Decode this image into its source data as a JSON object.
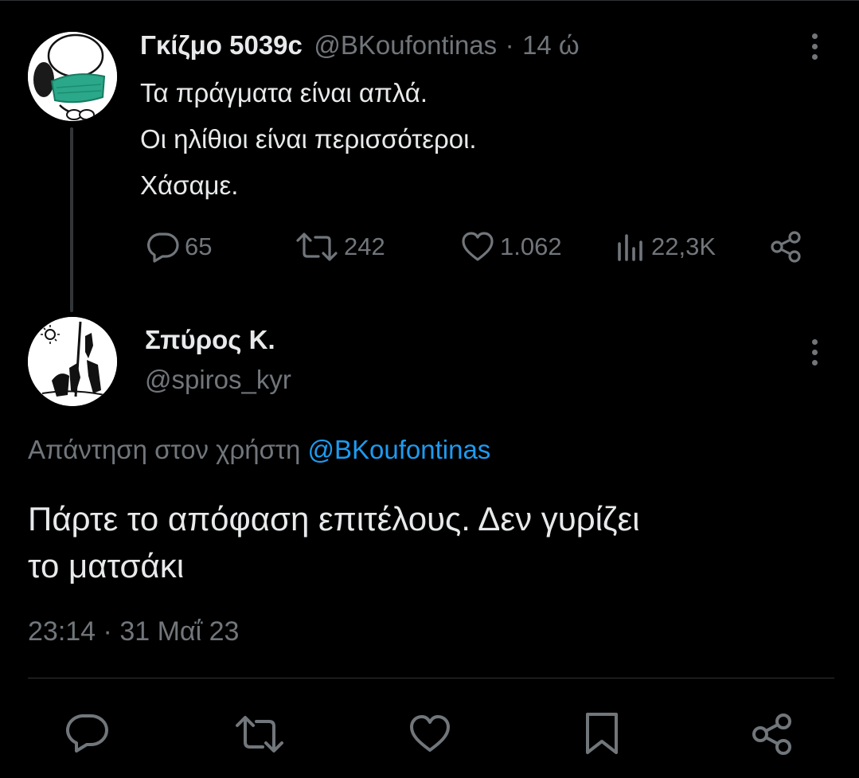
{
  "original_tweet": {
    "author_name": "Γκίζμο 5039c",
    "handle": "@BKoufontinas",
    "separator": "·",
    "time_ago": "14 ώ",
    "lines": [
      "Τα πράγματα είναι απλά.",
      "Οι ηλίθιοι είναι περισσότεροι.",
      "Χάσαμε."
    ],
    "stats": {
      "replies": "65",
      "retweets": "242",
      "likes": "1.062",
      "views": "22,3K"
    },
    "icons": [
      "reply-icon",
      "retweet-icon",
      "like-icon",
      "views-icon",
      "share-icon",
      "more-icon"
    ]
  },
  "reply_tweet": {
    "author_name": "Σπύρος Κ.",
    "handle": "@spiros_kyr",
    "reply_prefix": "Απάντηση στον χρήστη",
    "reply_mention": "@BKoufontinas",
    "text_line1": "Πάρτε το απόφαση επιτέλους. Δεν γυρίζει",
    "text_line2": "το ματσάκι",
    "timestamp": "23:14",
    "separator": "·",
    "date": "31 Μαΐ 23"
  },
  "bottom_actions": [
    "reply-icon",
    "retweet-icon",
    "like-icon",
    "bookmark-icon",
    "share-icon"
  ],
  "colors": {
    "background": "#000000",
    "text": "#e7e9ea",
    "muted": "#71767b",
    "link": "#1d9bf0",
    "mask": "#2aa889"
  }
}
